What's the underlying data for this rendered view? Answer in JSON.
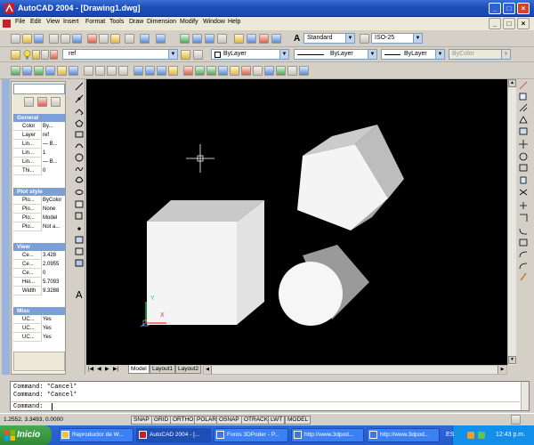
{
  "window": {
    "title": "AutoCAD 2004 - [Drawing1.dwg]",
    "min_label": "_",
    "max_label": "□",
    "close_label": "×"
  },
  "menu": [
    "File",
    "Edit",
    "View",
    "Insert",
    "Format",
    "Tools",
    "Draw",
    "Dimension",
    "Modify",
    "Window",
    "Help"
  ],
  "styles_toolbar": {
    "text_style": "Standard",
    "dim_style": "ISO-25"
  },
  "layer_toolbar": {
    "layer": "ref",
    "color": "ByLayer",
    "linetype": "ByLayer",
    "lineweight": "ByLayer",
    "plotstyle": "ByColor"
  },
  "properties": {
    "sections": [
      {
        "title": "General",
        "rows": [
          {
            "k": "Color",
            "v": "By..."
          },
          {
            "k": "Layer",
            "v": "ref"
          },
          {
            "k": "Lin...",
            "v": "— B..."
          },
          {
            "k": "Lin...",
            "v": "1"
          },
          {
            "k": "Lin...",
            "v": "— B..."
          },
          {
            "k": "Thi...",
            "v": "0"
          }
        ]
      },
      {
        "title": "Plot style",
        "rows": [
          {
            "k": "Plo...",
            "v": "ByColor"
          },
          {
            "k": "Plo...",
            "v": "None"
          },
          {
            "k": "Plo...",
            "v": "Model"
          },
          {
            "k": "Plo...",
            "v": "Not a..."
          }
        ]
      },
      {
        "title": "View",
        "rows": [
          {
            "k": "Ce...",
            "v": "3.428"
          },
          {
            "k": "Ce...",
            "v": "2.0955"
          },
          {
            "k": "Ce...",
            "v": "0"
          },
          {
            "k": "Hei...",
            "v": "5.7093"
          },
          {
            "k": "Width",
            "v": "9.3288"
          }
        ]
      },
      {
        "title": "Misc",
        "rows": [
          {
            "k": "UC...",
            "v": "Yes"
          },
          {
            "k": "UC...",
            "v": "Yes"
          },
          {
            "k": "UC...",
            "v": "Yes"
          }
        ]
      }
    ]
  },
  "ucs": {
    "x_label": "X",
    "y_label": "Y"
  },
  "layout_tabs": [
    "Model",
    "Layout1",
    "Layout2"
  ],
  "command": {
    "history": [
      "Command: *Cancel*",
      "Command: *Cancel*"
    ],
    "prompt": "Command:"
  },
  "status": {
    "coords": "1.2552, 3.3493, 0.0000",
    "buttons": [
      "SNAP",
      "GRID",
      "ORTHO",
      "POLAR",
      "OSNAP",
      "OTRACK",
      "LWT",
      "MODEL"
    ]
  },
  "taskbar": {
    "start": "Inicio",
    "tasks": [
      "Reproductor de W...",
      "AutoCAD 2004 - [...",
      "Foros 3DPoder - P...",
      "http://www.3dpod...",
      "http://www.3dpod..."
    ],
    "lang": "ES",
    "clock": "12:43 p.m."
  },
  "colors": {
    "canvas": "#000000",
    "section_header": "#7b9fd6",
    "titlebar": "#1c4fb9",
    "taskbar": "#2a5fd0"
  },
  "icons": [
    "autocad-logo-icon",
    "crosshair-cursor-icon",
    "ucs-icon",
    "lightbulb-icon",
    "start-windows-icon"
  ]
}
